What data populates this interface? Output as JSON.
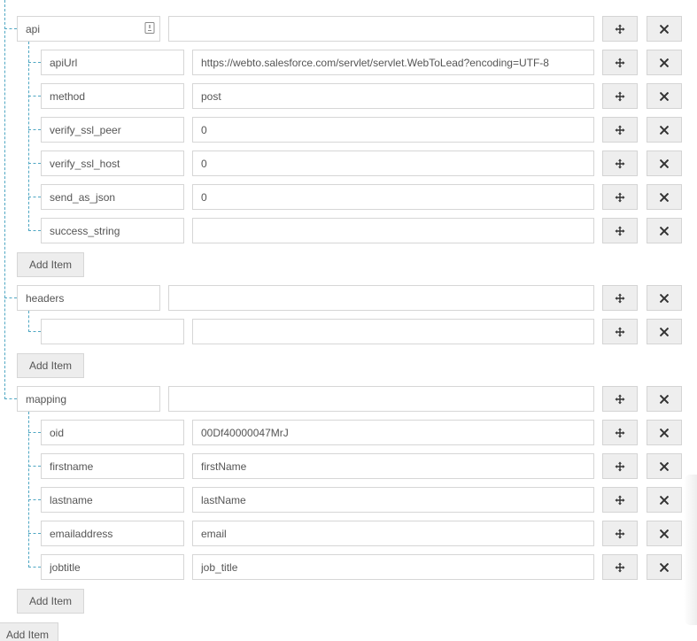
{
  "groups": [
    {
      "name": "api",
      "value": "",
      "add_item_label": "Add Item",
      "fields": [
        {
          "key": "apiUrl",
          "value": "https://webto.salesforce.com/servlet/servlet.WebToLead?encoding=UTF-8"
        },
        {
          "key": "method",
          "value": "post"
        },
        {
          "key": "verify_ssl_peer",
          "value": "0"
        },
        {
          "key": "verify_ssl_host",
          "value": "0"
        },
        {
          "key": "send_as_json",
          "value": "0"
        },
        {
          "key": "success_string",
          "value": ""
        }
      ]
    },
    {
      "name": "headers",
      "value": "",
      "add_item_label": "Add Item",
      "fields": [
        {
          "key": "",
          "value": ""
        }
      ]
    },
    {
      "name": "mapping",
      "value": "",
      "add_item_label": "Add Item",
      "fields": [
        {
          "key": "oid",
          "value": "00Df40000047MrJ"
        },
        {
          "key": "firstname",
          "value": "firstName"
        },
        {
          "key": "lastname",
          "value": "lastName"
        },
        {
          "key": "emailaddress",
          "value": "email"
        },
        {
          "key": "jobtitle",
          "value": "job_title"
        }
      ]
    }
  ],
  "root_add_item_label": "Add Item",
  "icons": {
    "move": "move-arrows-icon",
    "remove": "close-x-icon",
    "api_badge": "document-icon"
  },
  "colors": {
    "tree_line": "#4fa7c3",
    "border": "#d6d6d6",
    "button_bg": "#eeeeee",
    "text": "#555555"
  }
}
